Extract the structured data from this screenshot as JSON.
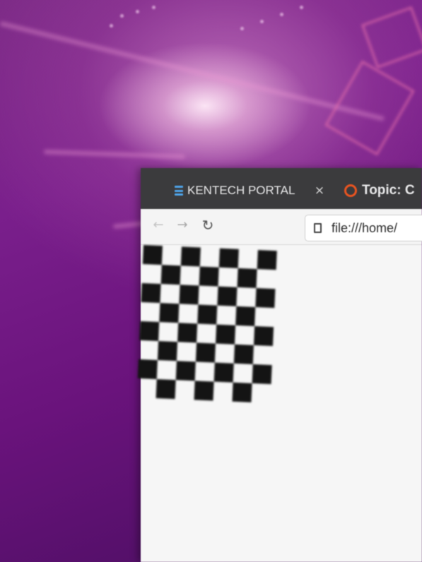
{
  "desktop": {
    "wallpaper": "purple-gradient"
  },
  "browser": {
    "tabs": [
      {
        "label": "KENTECH PORTAL",
        "icon": "list-icon",
        "icon_color": "#4ea3e8"
      },
      {
        "label": "Topic: C",
        "icon": "ubuntu-icon",
        "icon_color": "#e95420"
      }
    ],
    "tab_close_symbol": "×",
    "nav": {
      "back_symbol": "←",
      "forward_symbol": "→",
      "reload_symbol": "↻"
    },
    "address": {
      "value": "file:///home/"
    },
    "page": {
      "content": "checkerboard",
      "rows": 8,
      "cols": 7,
      "square_color": "#141414",
      "background": "#f6f6f6"
    }
  }
}
